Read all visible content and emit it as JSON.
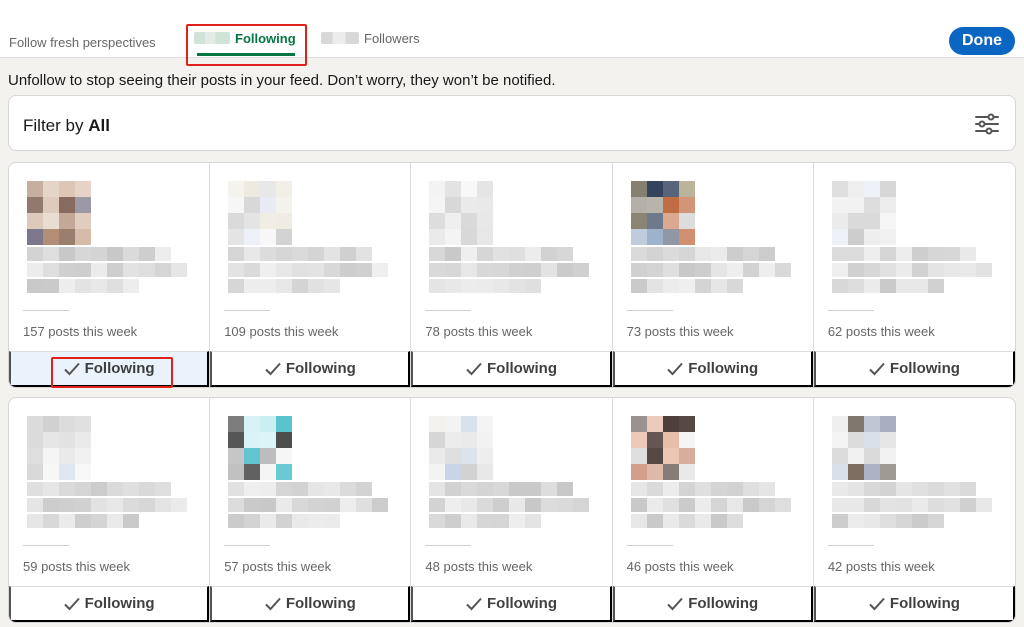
{
  "tabs": {
    "fresh": "Follow fresh perspectives",
    "following": "Following",
    "followers": "Followers"
  },
  "done_label": "Done",
  "description": "Unfollow to stop seeing their posts in your feed. Don’t worry, they won’t be notified.",
  "filter": {
    "prefix": "Filter by",
    "value": "All"
  },
  "follow_label": "Following",
  "cards_row1": [
    {
      "posts": "157 posts this week"
    },
    {
      "posts": "109 posts this week"
    },
    {
      "posts": "78 posts this week"
    },
    {
      "posts": "73 posts this week"
    },
    {
      "posts": "62 posts this week"
    }
  ],
  "cards_row2": [
    {
      "posts": "59 posts this week"
    },
    {
      "posts": "57 posts this week"
    },
    {
      "posts": "48 posts this week"
    },
    {
      "posts": "46 posts this week"
    },
    {
      "posts": "42 posts this week"
    }
  ],
  "colors": {
    "accent_green": "#057642",
    "primary_blue": "#0a66c2",
    "highlight_red": "#e0201a"
  }
}
